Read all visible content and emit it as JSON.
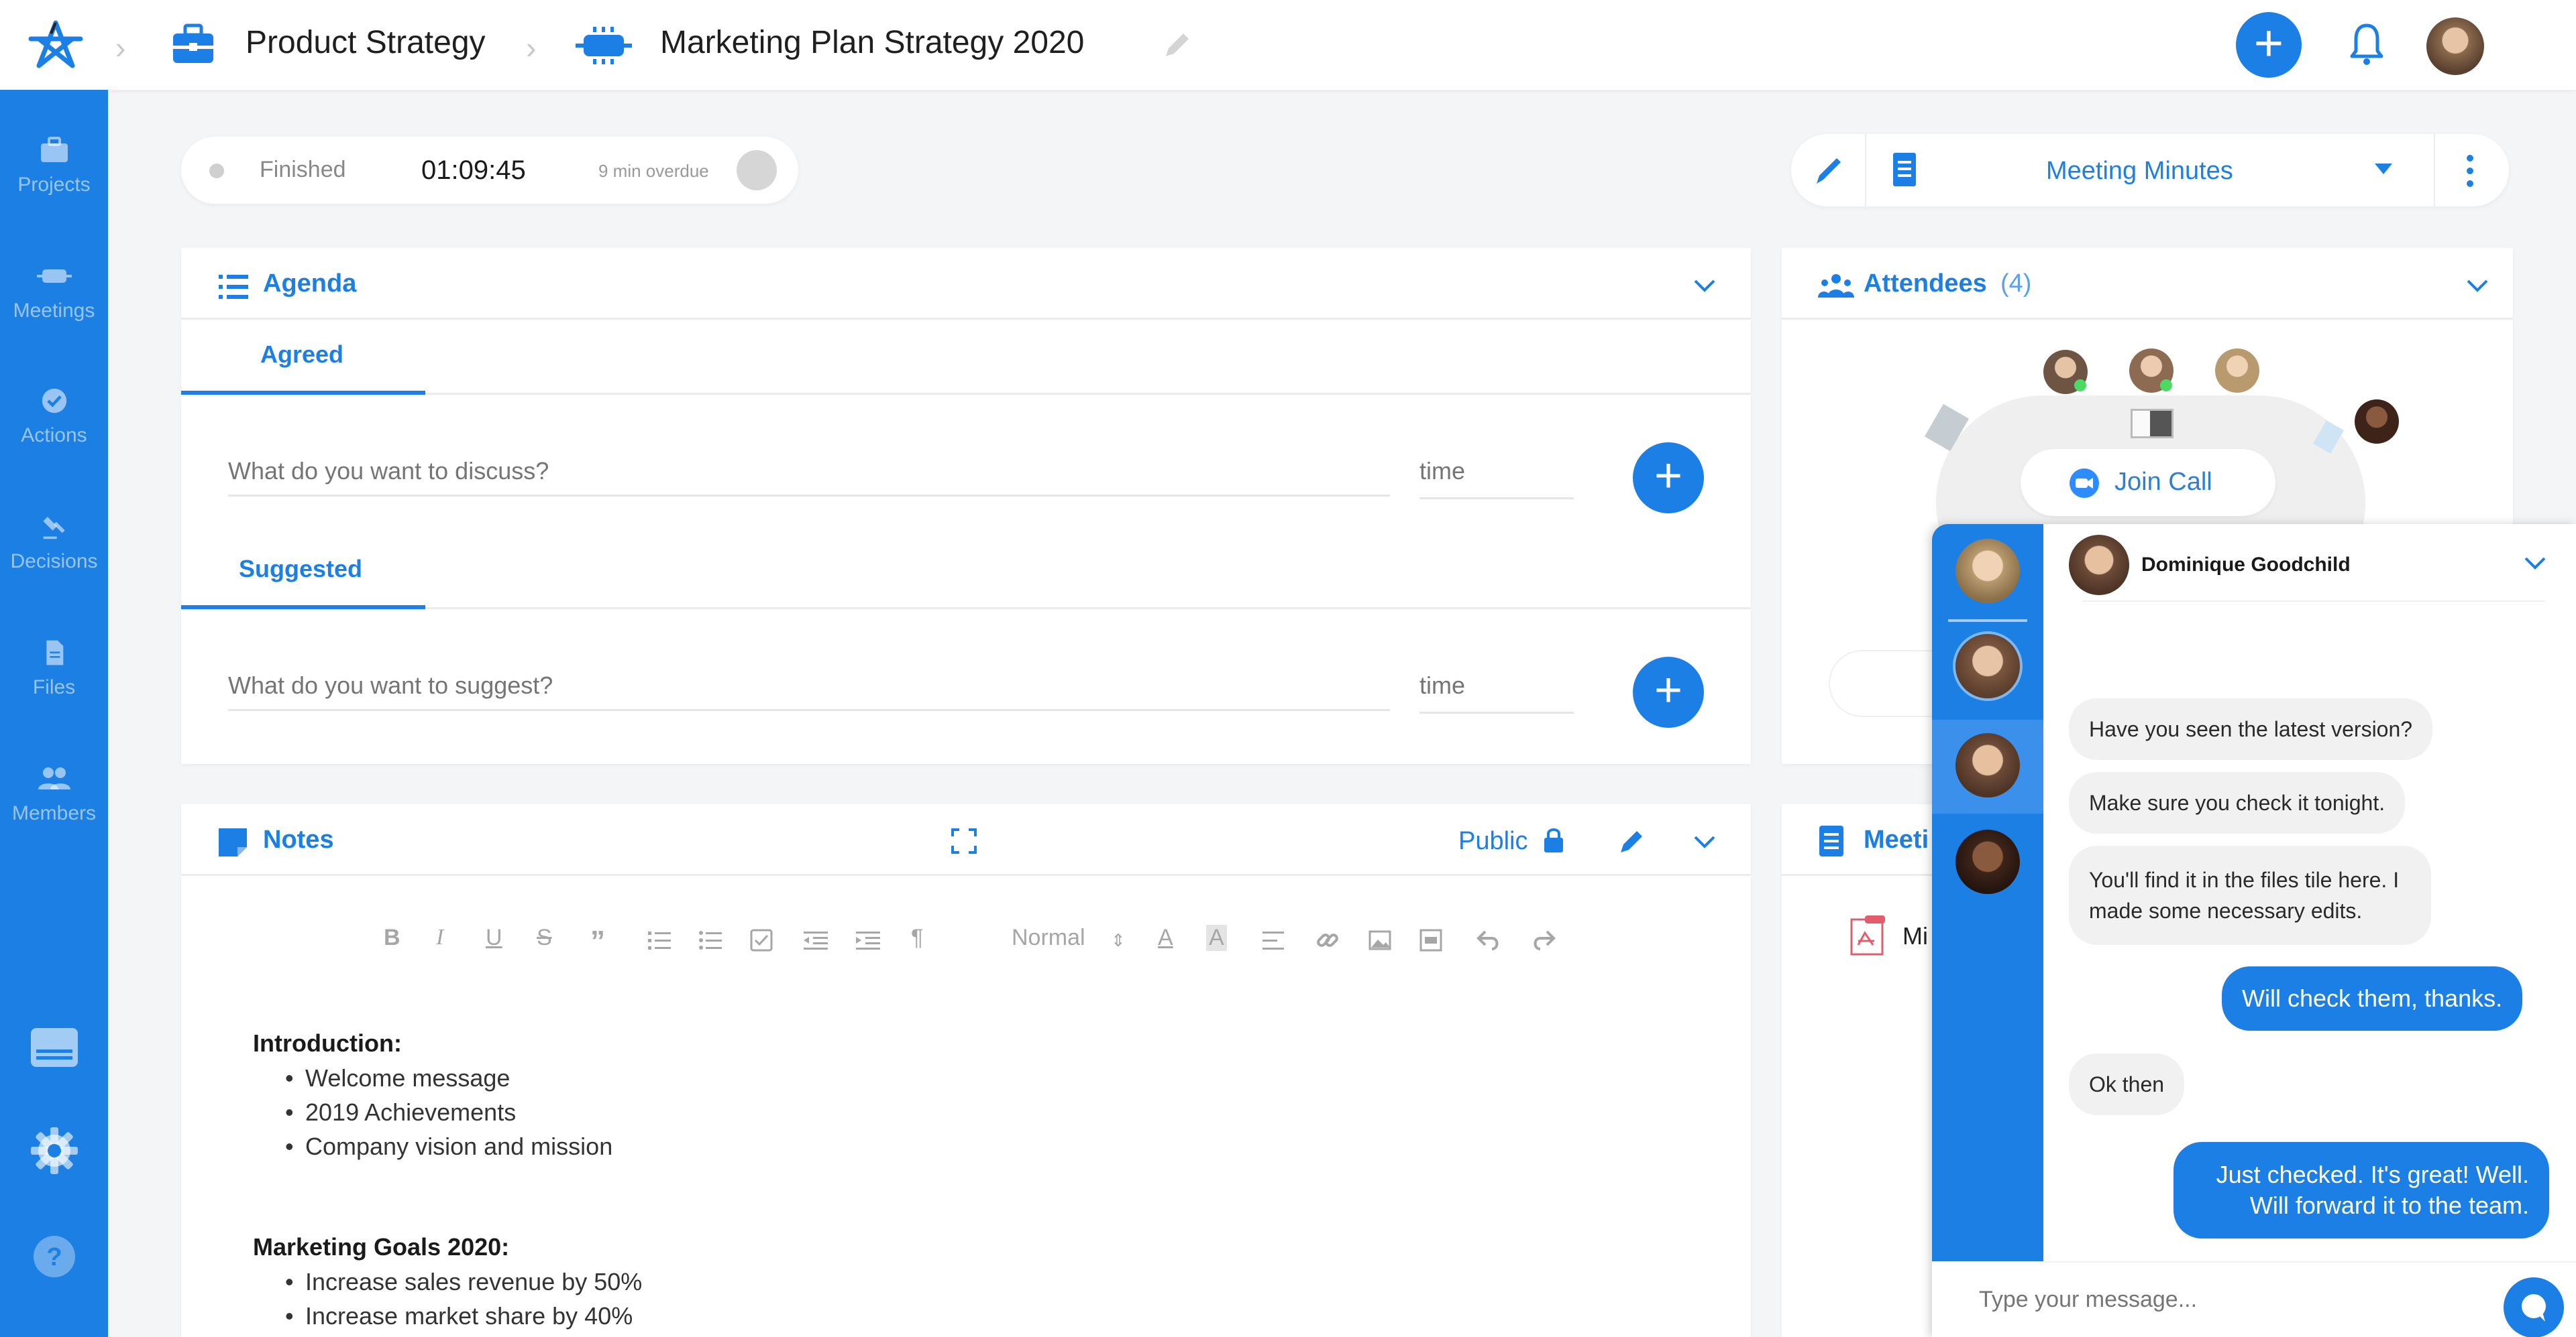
{
  "header": {
    "breadcrumb": [
      {
        "label": "Product Strategy",
        "icon": "briefcase-icon"
      },
      {
        "label": "Marketing Plan Strategy 2020",
        "icon": "meeting-icon"
      }
    ],
    "add_button": "+",
    "notifications_icon": "bell-icon"
  },
  "sidebar": {
    "items": [
      {
        "label": "Projects",
        "icon": "briefcase-icon"
      },
      {
        "label": "Meetings",
        "icon": "meeting-icon"
      },
      {
        "label": "Actions",
        "icon": "check-circle-icon"
      },
      {
        "label": "Decisions",
        "icon": "gavel-icon"
      },
      {
        "label": "Files",
        "icon": "file-icon"
      },
      {
        "label": "Members",
        "icon": "members-icon"
      }
    ],
    "bottom": [
      {
        "icon": "card-icon"
      },
      {
        "icon": "gear-icon"
      },
      {
        "icon": "help-icon"
      }
    ]
  },
  "status": {
    "state": "Finished",
    "timer": "01:09:45",
    "overdue": "9 min overdue"
  },
  "minutes_toolbar": {
    "title": "Meeting Minutes"
  },
  "agenda": {
    "title": "Agenda",
    "sections": [
      {
        "tab": "Agreed",
        "placeholder": "What do you want to discuss?",
        "time_placeholder": "time"
      },
      {
        "tab": "Suggested",
        "placeholder": "What do you want to suggest?",
        "time_placeholder": "time"
      }
    ]
  },
  "notes": {
    "title": "Notes",
    "visibility": "Public",
    "format_select": "Normal",
    "toolbar": [
      "B",
      "I",
      "U",
      "S",
      "”",
      "ol",
      "ul",
      "check",
      "outdent",
      "indent",
      "para",
      "Normal",
      "A",
      "bgA",
      "align",
      "link",
      "image",
      "video",
      "undo",
      "redo"
    ],
    "content": [
      {
        "heading": "Introduction:",
        "items": [
          "Welcome message",
          "2019 Achievements",
          "Company vision and mission"
        ]
      },
      {
        "heading": "Marketing Goals 2020:",
        "items": [
          "Increase sales revenue by 50%",
          "Increase market share by 40%"
        ]
      }
    ]
  },
  "attendees": {
    "title": "Attendees",
    "count": "(4)",
    "join_call": "Join Call"
  },
  "minutes_card": {
    "title": "Meeti",
    "file_label": "Mi"
  },
  "chat": {
    "contact_name": "Dominique Goodchild",
    "messages": [
      {
        "from": "them",
        "text": "Have you seen the latest version?"
      },
      {
        "from": "them",
        "text": "Make sure you check it tonight."
      },
      {
        "from": "them",
        "text": "You'll find it in the files tile here. I made some necessary edits."
      },
      {
        "from": "me",
        "text": "Will check them, thanks."
      },
      {
        "from": "them",
        "text": "Ok then"
      },
      {
        "from": "me",
        "text": "Just checked. It's great! Well. Will forward it to the team."
      }
    ],
    "input_placeholder": "Type your message..."
  },
  "colors": {
    "accent": "#1c7fe6",
    "sidebar": "#1b7fe4",
    "bubble_in": "#f1f1f1",
    "online": "#4cd964"
  }
}
